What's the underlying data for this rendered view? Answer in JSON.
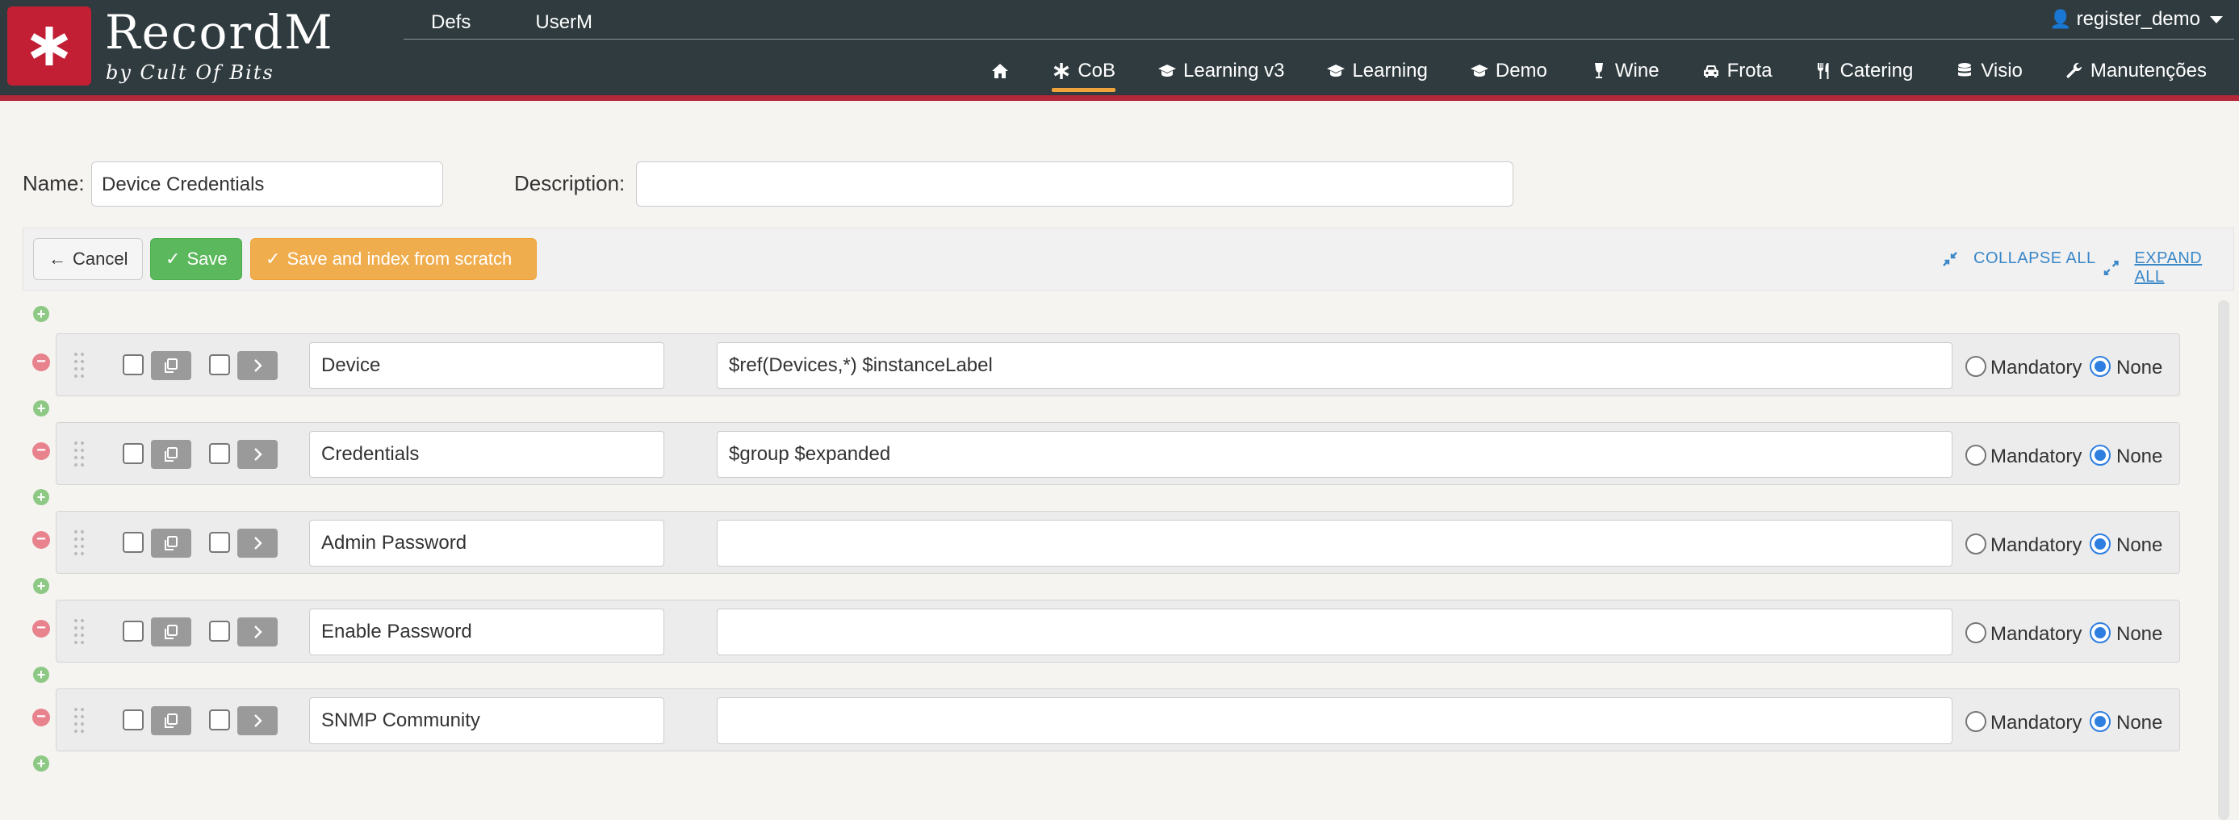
{
  "app": {
    "title": "RecordM",
    "subtitle": "by Cult Of Bits"
  },
  "topnav": {
    "items": [
      "Defs",
      "UserM"
    ]
  },
  "user": {
    "name": "register_demo"
  },
  "mainnav": {
    "items": [
      {
        "label": "",
        "icon": "home-icon"
      },
      {
        "label": "CoB",
        "icon": "asterisk-icon",
        "active": true
      },
      {
        "label": "Learning v3",
        "icon": "graduation-cap-icon"
      },
      {
        "label": "Learning",
        "icon": "graduation-cap-icon"
      },
      {
        "label": "Demo",
        "icon": "graduation-cap-icon"
      },
      {
        "label": "Wine",
        "icon": "wine-glass-icon"
      },
      {
        "label": "Frota",
        "icon": "car-icon"
      },
      {
        "label": "Catering",
        "icon": "cutlery-icon"
      },
      {
        "label": "Visio",
        "icon": "database-icon"
      },
      {
        "label": "Manutenções",
        "icon": "wrench-icon"
      }
    ]
  },
  "form": {
    "name_label": "Name:",
    "name_value": "Device Credentials",
    "description_label": "Description:",
    "description_value": ""
  },
  "toolbar": {
    "cancel_label": "Cancel",
    "save_label": "Save",
    "save_index_label": "Save and index from scratch",
    "collapse_all": "COLLAPSE ALL",
    "expand_all": "EXPAND ALL"
  },
  "fields": [
    {
      "name": "Device",
      "description": "$ref(Devices,*) $instanceLabel",
      "mandatory_label": "Mandatory",
      "none_label": "None",
      "selected": "None"
    },
    {
      "name": "Credentials",
      "description": "$group $expanded",
      "mandatory_label": "Mandatory",
      "none_label": "None",
      "selected": "None"
    },
    {
      "name": "Admin Password",
      "description": "",
      "mandatory_label": "Mandatory",
      "none_label": "None",
      "selected": "None"
    },
    {
      "name": "Enable Password",
      "description": "",
      "mandatory_label": "Mandatory",
      "none_label": "None",
      "selected": "None"
    },
    {
      "name": "SNMP Community",
      "description": "",
      "mandatory_label": "Mandatory",
      "none_label": "None",
      "selected": "None"
    }
  ],
  "colors": {
    "header_bg": "#2f3b3f",
    "brand_red": "#c21e34",
    "save_green": "#5cb85c",
    "save_index_orange": "#f0ad4e",
    "link_blue": "#3a87c8",
    "active_underline": "#f0a33a"
  }
}
